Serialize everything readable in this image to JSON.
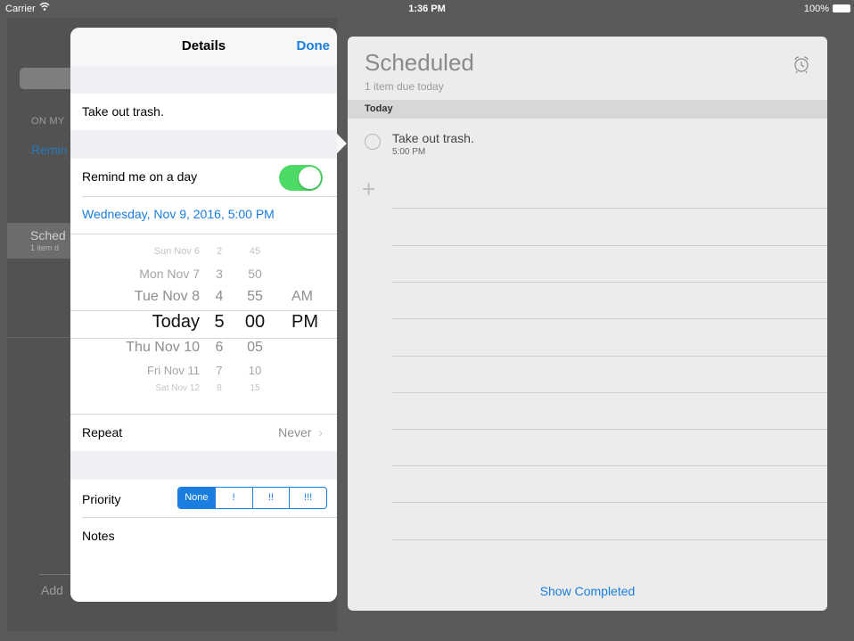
{
  "status_bar": {
    "carrier": "Carrier",
    "time": "1:36 PM",
    "battery": "100%"
  },
  "background_sidebar": {
    "section_label": "ON MY",
    "list_name": "Remin",
    "selected_item": "Sched",
    "selected_sub": "1 item d",
    "add_label": "Add"
  },
  "list": {
    "title": "Scheduled",
    "subtitle": "1 item due today",
    "section": "Today",
    "task_title": "Take out trash.",
    "task_time": "5:00 PM",
    "show_completed": "Show Completed",
    "icons": {
      "alarm": "alarm-clock-icon",
      "add": "plus-icon",
      "checkbox": "circle-icon"
    }
  },
  "details": {
    "nav_title": "Details",
    "done": "Done",
    "reminder_title": "Take out trash.",
    "remind_label": "Remind me on a day",
    "remind_enabled": true,
    "date_value": "Wednesday, Nov 9, 2016, 5:00 PM",
    "picker": {
      "rows": [
        {
          "day": "Sun Nov 6",
          "hour": "2",
          "minute": "45",
          "ampm": ""
        },
        {
          "day": "Mon Nov 7",
          "hour": "3",
          "minute": "50",
          "ampm": ""
        },
        {
          "day": "Tue Nov 8",
          "hour": "4",
          "minute": "55",
          "ampm": "AM"
        },
        {
          "day": "Today",
          "hour": "5",
          "minute": "00",
          "ampm": "PM"
        },
        {
          "day": "Thu Nov 10",
          "hour": "6",
          "minute": "05",
          "ampm": ""
        },
        {
          "day": "Fri Nov 11",
          "hour": "7",
          "minute": "10",
          "ampm": ""
        },
        {
          "day": "Sat Nov 12",
          "hour": "8",
          "minute": "15",
          "ampm": ""
        }
      ]
    },
    "repeat_label": "Repeat",
    "repeat_value": "Never",
    "priority_label": "Priority",
    "priority_options": [
      "None",
      "!",
      "!!",
      "!!!"
    ],
    "priority_selected": "None",
    "notes_label": "Notes"
  },
  "colors": {
    "accent": "#1a7ee0",
    "toggle_on": "#4cd964"
  }
}
